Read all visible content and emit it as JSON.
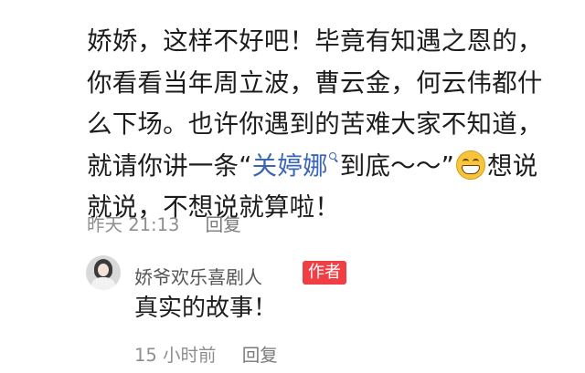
{
  "comment": {
    "lines": [
      "娇娇，这样不好吧！毕竟有知遇之恩的，",
      "你看看当年周立波，曹云金，何云伟都什",
      "么下场。也许你遇到的苦难大家不知道，"
    ],
    "line4_prefix": "就请你讲一条“",
    "topic": "关婷娜",
    "line4_suffix": "到底～～”",
    "emoji_icon": "grinning-face-icon",
    "line4_end": "想说",
    "line5": "就说，不想说就算啦！",
    "timestamp": "昨天 21:13",
    "reply_label": "回复"
  },
  "reply": {
    "username": "娇爷欢乐喜剧人",
    "badge": "作者",
    "badge_color": "#ef3f45",
    "text": "真实的故事！",
    "timestamp": "15 小时前",
    "reply_label": "回复"
  },
  "colors": {
    "topic_link": "#3a66b5",
    "meta_text": "#8e8e8e"
  }
}
